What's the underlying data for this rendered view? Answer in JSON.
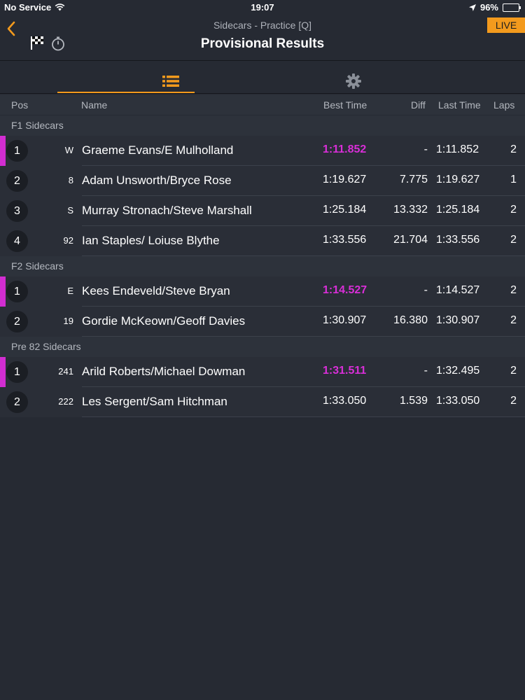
{
  "status": {
    "carrier": "No Service",
    "time": "19:07",
    "battery": "96%"
  },
  "nav": {
    "subtitle": "Sidecars - Practice [Q]",
    "title": "Provisional Results",
    "live": "LIVE"
  },
  "columns": {
    "pos": "Pos",
    "name": "Name",
    "best": "Best Time",
    "diff": "Diff",
    "last": "Last Time",
    "laps": "Laps"
  },
  "sections": [
    {
      "title": "F1 Sidecars",
      "rows": [
        {
          "pos": "1",
          "num": "W",
          "name": "Graeme Evans/E Mulholland",
          "best": "1:11.852",
          "diff": "-",
          "last": "1:11.852",
          "laps": "2"
        },
        {
          "pos": "2",
          "num": "8",
          "name": "Adam Unsworth/Bryce Rose",
          "best": "1:19.627",
          "diff": "7.775",
          "last": "1:19.627",
          "laps": "1"
        },
        {
          "pos": "3",
          "num": "S",
          "name": "Murray Stronach/Steve Marshall",
          "best": "1:25.184",
          "diff": "13.332",
          "last": "1:25.184",
          "laps": "2"
        },
        {
          "pos": "4",
          "num": "92",
          "name": "Ian Staples/ Loiuse Blythe",
          "best": "1:33.556",
          "diff": "21.704",
          "last": "1:33.556",
          "laps": "2"
        }
      ]
    },
    {
      "title": "F2 Sidecars",
      "rows": [
        {
          "pos": "1",
          "num": "E",
          "name": "Kees Endeveld/Steve Bryan",
          "best": "1:14.527",
          "diff": "-",
          "last": "1:14.527",
          "laps": "2"
        },
        {
          "pos": "2",
          "num": "19",
          "name": "Gordie McKeown/Geoff Davies",
          "best": "1:30.907",
          "diff": "16.380",
          "last": "1:30.907",
          "laps": "2"
        }
      ]
    },
    {
      "title": "Pre 82 Sidecars",
      "rows": [
        {
          "pos": "1",
          "num": "241",
          "name": "Arild Roberts/Michael Dowman",
          "best": "1:31.511",
          "diff": "-",
          "last": "1:32.495",
          "laps": "2"
        },
        {
          "pos": "2",
          "num": "222",
          "name": "Les Sergent/Sam Hitchman",
          "best": "1:33.050",
          "diff": "1.539",
          "last": "1:33.050",
          "laps": "2"
        }
      ]
    }
  ],
  "colors": {
    "accent": "#f39a1d",
    "highlight": "#d92ed8",
    "background": "#262a33"
  },
  "icons": [
    "wifi-icon",
    "location-arrow-icon",
    "battery-icon",
    "back-chevron-icon",
    "checkered-flag-icon",
    "stopwatch-icon",
    "list-icon",
    "gear-icon"
  ]
}
